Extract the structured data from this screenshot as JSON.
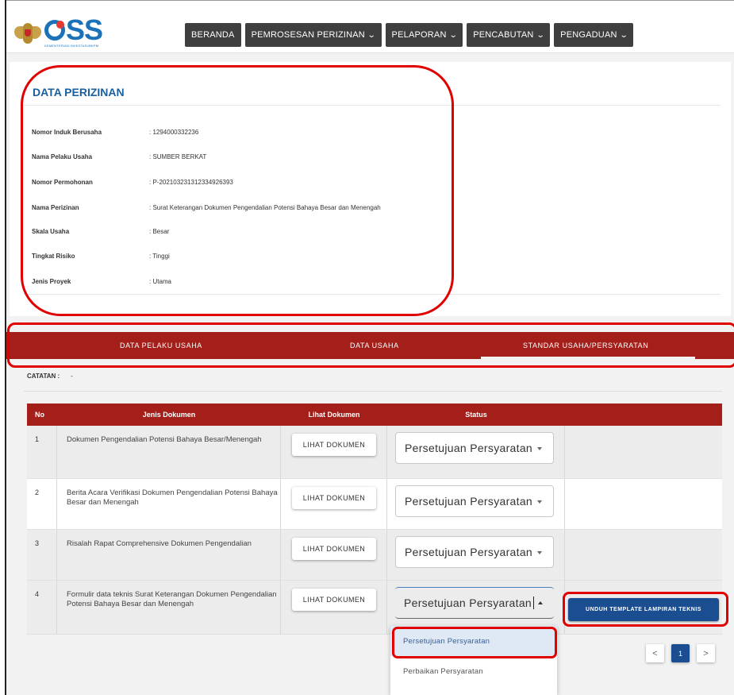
{
  "nav": {
    "items": [
      {
        "label": "BERANDA",
        "dropdown": false
      },
      {
        "label": "PEMROSESAN PERIZINAN",
        "dropdown": true
      },
      {
        "label": "PELAPORAN",
        "dropdown": true
      },
      {
        "label": "PENCABUTAN",
        "dropdown": true
      },
      {
        "label": "PENGADUAN",
        "dropdown": true
      }
    ]
  },
  "logo": {
    "text": "SS",
    "subtitle": "KEMENTERIAN INVESTASI/BKPM"
  },
  "data_perizinan": {
    "title": "DATA PERIZINAN",
    "fields": [
      {
        "label": "Nomor Induk Berusaha",
        "value": ": 1294000332236"
      },
      {
        "label": "Nama Pelaku Usaha",
        "value": ": SUMBER BERKAT"
      },
      {
        "label": "Nomor Permohonan",
        "value": ": P-202103231312334926393"
      },
      {
        "label": "Nama Perizinan",
        "value": ": Surat Keterangan Dokumen Pengendalian Potensi Bahaya Besar dan Menengah"
      },
      {
        "label": "Skala Usaha",
        "value": ": Besar"
      },
      {
        "label": "Tingkat Risiko",
        "value": ": Tinggi"
      },
      {
        "label": "Jenis Proyek",
        "value": ": Utama"
      }
    ]
  },
  "tabs": [
    {
      "label": "DATA PELAKU USAHA"
    },
    {
      "label": "DATA USAHA"
    },
    {
      "label": "STANDAR USAHA/PERSYARATAN",
      "active": true
    }
  ],
  "catatan": {
    "label": "CATATAN :",
    "value": "-"
  },
  "table": {
    "headers": [
      "No",
      "Jenis Dokumen",
      "Lihat Dokumen",
      "Status",
      ""
    ],
    "rows": [
      {
        "no": "1",
        "jenis": "Dokumen Pengendalian Potensi Bahaya Besar/Menengah",
        "lihat": "LIHAT DOKUMEN",
        "status": "Persetujuan Persyaratan"
      },
      {
        "no": "2",
        "jenis": "Berita Acara Verifikasi Dokumen Pengendalian Potensi Bahaya Besar dan Menengah",
        "lihat": "LIHAT DOKUMEN",
        "status": "Persetujuan Persyaratan"
      },
      {
        "no": "3",
        "jenis": "Risalah Rapat Comprehensive Dokumen Pengendalian",
        "lihat": "LIHAT DOKUMEN",
        "status": "Persetujuan Persyaratan"
      },
      {
        "no": "4",
        "jenis": "Formulir data teknis Surat Keterangan Dokumen Pengendalian Potensi Bahaya Besar dan Menengah",
        "lihat": "LIHAT DOKUMEN",
        "status": "Persetujuan Persyaratan",
        "action": "UNDUH TEMPLATE LAMPIRAN TEKNIS"
      }
    ]
  },
  "dropdown": {
    "options": [
      "Persetujuan Persyaratan",
      "Perbaikan Persyaratan"
    ],
    "selected": "Persetujuan Persyaratan"
  },
  "pagination": {
    "prev": "<",
    "current": "1",
    "next": ">"
  },
  "colors": {
    "brand_red": "#a41f1a",
    "brand_blue": "#1b4e91",
    "title_blue": "#1a5f9e",
    "annotation_red": "#e00000"
  }
}
